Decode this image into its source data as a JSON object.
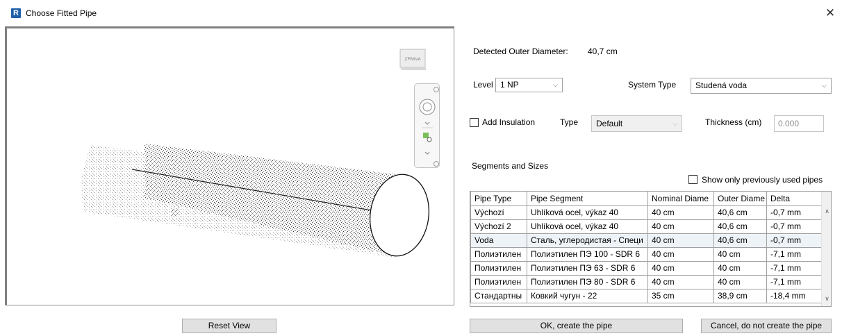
{
  "window": {
    "title": "Choose Fitted Pipe",
    "logo_letter": "R",
    "close_glyph": "✕"
  },
  "viewport": {
    "viewcube_label": "ZPRAVA"
  },
  "detected": {
    "label": "Detected Outer Diameter:",
    "value": "40,7 cm"
  },
  "level": {
    "label": "Level",
    "value": "1 NP"
  },
  "system_type": {
    "label": "System Type",
    "value": "Studená voda"
  },
  "insulation": {
    "checkbox_label": "Add Insulation",
    "checked": false,
    "type_label": "Type",
    "type_value": "Default",
    "thickness_label": "Thickness (cm)",
    "thickness_value": "0.000"
  },
  "segments": {
    "label": "Segments and Sizes",
    "show_only_label": "Show only previously used pipes",
    "show_only_checked": false
  },
  "grid": {
    "columns": [
      "Pipe Type",
      "Pipe Segment",
      "Nominal Diame",
      "Outer Diame",
      "Delta"
    ],
    "rows": [
      [
        "Výchozí",
        "Uhlíková ocel, výkaz 40",
        "40 cm",
        "40,6 cm",
        "-0,7 mm"
      ],
      [
        "Výchozí 2",
        "Uhlíková ocel, výkaz 40",
        "40 cm",
        "40,6 cm",
        "-0,7 mm"
      ],
      [
        "Voda",
        "Сталь, углеродистая - Специ",
        "40 cm",
        "40,6 cm",
        "-0,7 mm"
      ],
      [
        "Полиэтилен",
        "Полиэтилен ПЭ 100 - SDR 6",
        "40 cm",
        "40 cm",
        "-7,1 mm"
      ],
      [
        "Полиэтилен",
        "Полиэтилен ПЭ 63 - SDR 6",
        "40 cm",
        "40 cm",
        "-7,1 mm"
      ],
      [
        "Полиэтилен",
        "Полиэтилен ПЭ 80 - SDR 6",
        "40 cm",
        "40 cm",
        "-7,1 mm"
      ],
      [
        "Стандартны",
        "Ковкий чугун - 22",
        "35 cm",
        "38,9 cm",
        "-18,4 mm"
      ]
    ]
  },
  "buttons": {
    "reset": "Reset View",
    "ok": "OK, create the pipe",
    "cancel": "Cancel, do not create the pipe"
  },
  "colors": {
    "logo": "#1f5fa9",
    "button_face": "#e1e1e1",
    "disabled_field": "#f0f0f0"
  }
}
